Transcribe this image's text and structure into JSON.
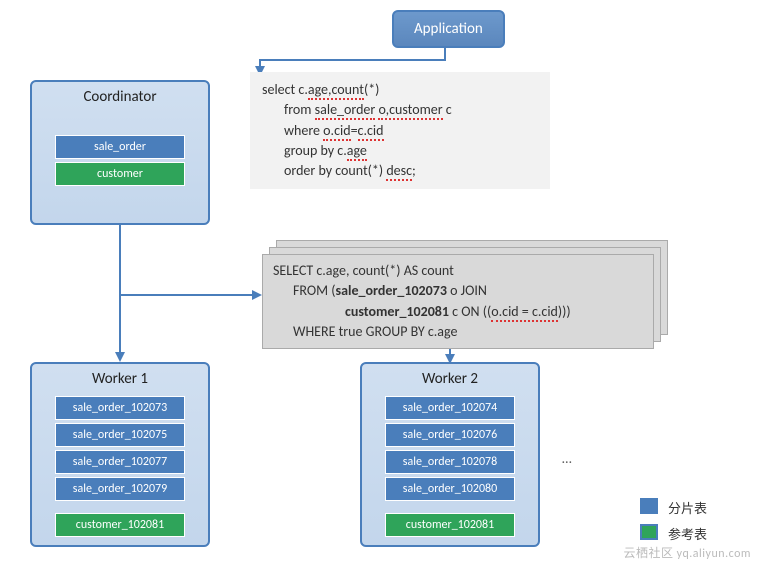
{
  "application": {
    "label": "Application"
  },
  "coordinator": {
    "title": "Coordinator",
    "tables": [
      "sale_order",
      "customer"
    ]
  },
  "sql1": {
    "line1a": "select c.",
    "line1b": "age,count",
    "line1c": "(*)",
    "line2a": "from ",
    "line2b": "sale_order",
    "line2c": " ",
    "line2d": "o,customer",
    "line2e": " c",
    "line3a": "where ",
    "line3b": "o.cid",
    "line3c": "=",
    "line3d": "c.cid",
    "line4a": "group by c.",
    "line4b": "age",
    "line5a": "order by count(*) ",
    "line5b": "desc",
    "line5c": ";"
  },
  "sql2": {
    "line1": "SELECT c.age, count(*) AS count",
    "line2a": "FROM (",
    "line2b": "sale_order_102073",
    "line2c": " o JOIN",
    "line3a": "customer_102081",
    "line3b": " c ON ((",
    "line3c": "o.cid = c.cid",
    "line3d": ")))",
    "line4": "WHERE true GROUP BY c.age"
  },
  "workers": [
    {
      "title": "Worker 1",
      "shards": [
        "sale_order_102073",
        "sale_order_102075",
        "sale_order_102077",
        "sale_order_102079"
      ],
      "ref": "customer_102081"
    },
    {
      "title": "Worker 2",
      "shards": [
        "sale_order_102074",
        "sale_order_102076",
        "sale_order_102078",
        "sale_order_102080"
      ],
      "ref": "customer_102081"
    }
  ],
  "ellipsis": "…",
  "legend": {
    "shard": "分片表",
    "ref": "参考表"
  },
  "watermark": "云栖社区 yq.aliyun.com"
}
